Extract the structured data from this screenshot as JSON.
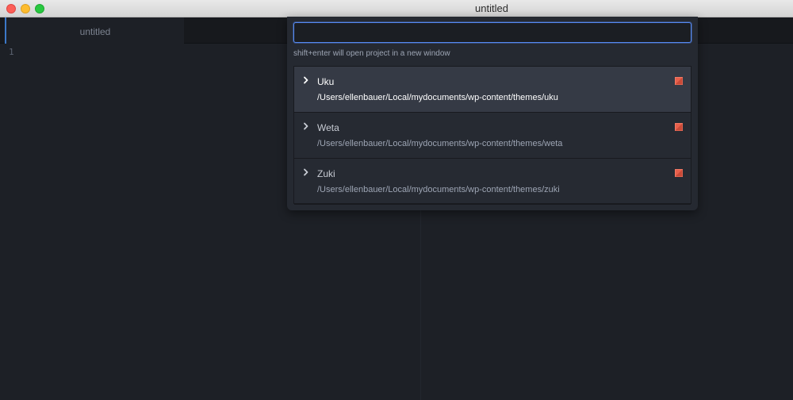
{
  "window": {
    "title": "untitled"
  },
  "tabs": [
    {
      "label": "untitled"
    }
  ],
  "editor": {
    "line_numbers": [
      "1"
    ]
  },
  "project_finder": {
    "search_value": "",
    "hint": "shift+enter will open project in a new window",
    "projects": [
      {
        "name": "Uku",
        "path": "/Users/ellenbauer/Local/mydocuments/wp-content/themes/uku",
        "selected": true
      },
      {
        "name": "Weta",
        "path": "/Users/ellenbauer/Local/mydocuments/wp-content/themes/weta",
        "selected": false
      },
      {
        "name": "Zuki",
        "path": "/Users/ellenbauer/Local/mydocuments/wp-content/themes/zuki",
        "selected": false
      }
    ]
  },
  "icons": {
    "expand": "chevron-right-icon",
    "project_marker": "project-color-icon"
  },
  "colors": {
    "accent": "#568af2",
    "project_marker": "#e8604c",
    "selected_row": "#353a45"
  }
}
